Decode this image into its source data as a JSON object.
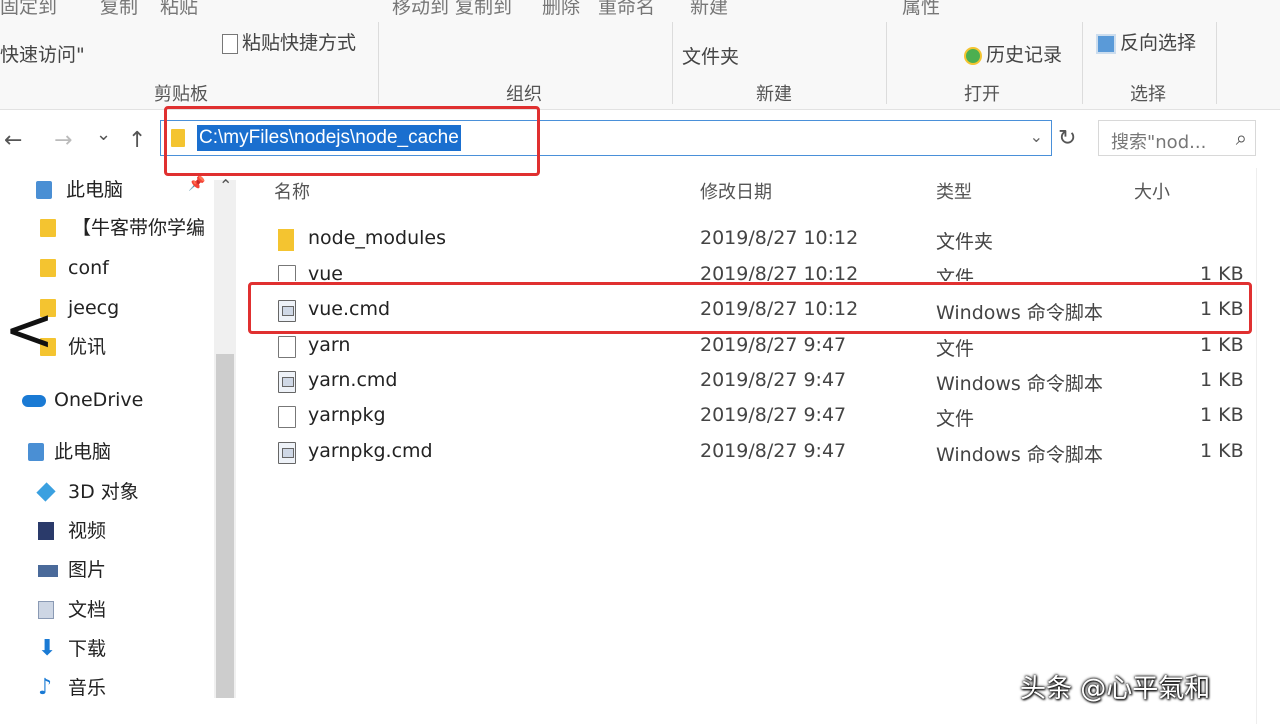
{
  "ribbon": {
    "top_fragments": [
      "固定到",
      "复制",
      "粘贴",
      "移动到 复制到",
      "删除",
      "重命名",
      "新建",
      "属性"
    ],
    "pin_quick_access": "快速访问\"",
    "paste_shortcut": "粘贴快捷方式",
    "new_folder": "文件夹",
    "history": "历史记录",
    "invert_selection": "反向选择",
    "groups": {
      "clipboard": "剪贴板",
      "organize": "组织",
      "new": "新建",
      "open": "打开",
      "select": "选择"
    }
  },
  "nav": {
    "back": "←",
    "forward": "→",
    "recent": "⌄",
    "up": "↑",
    "address_path": "C:\\myFiles\\nodejs\\node_cache",
    "dropdown": "⌄",
    "refresh": "↻",
    "search_placeholder": "搜索\"nod...",
    "search_icon": "⌕"
  },
  "sidebar": {
    "items": [
      {
        "label": "此电脑",
        "icon": "pc-icon"
      },
      {
        "label": "【牛客带你学编",
        "icon": "folder-icon"
      },
      {
        "label": "conf",
        "icon": "folder-icon"
      },
      {
        "label": "jeecg",
        "icon": "folder-icon"
      },
      {
        "label": "优讯",
        "icon": "folder-icon"
      },
      {
        "label": "OneDrive",
        "icon": "onedrive-icon"
      },
      {
        "label": "此电脑",
        "icon": "pc-icon"
      },
      {
        "label": "3D 对象",
        "icon": "3d-objects-icon"
      },
      {
        "label": "视频",
        "icon": "video-icon"
      },
      {
        "label": "图片",
        "icon": "pictures-icon"
      },
      {
        "label": "文档",
        "icon": "documents-icon"
      },
      {
        "label": "下载",
        "icon": "downloads-icon"
      },
      {
        "label": "音乐",
        "icon": "music-icon"
      }
    ],
    "back_overlay": "<"
  },
  "columns": {
    "name": "名称",
    "date": "修改日期",
    "type": "类型",
    "size": "大小"
  },
  "files": [
    {
      "name": "node_modules",
      "date": "2019/8/27 10:12",
      "type": "文件夹",
      "size": "",
      "icon": "folder-icon"
    },
    {
      "name": "vue",
      "date": "2019/8/27 10:12",
      "type": "文件",
      "size": "1 KB",
      "icon": "file-icon"
    },
    {
      "name": "vue.cmd",
      "date": "2019/8/27 10:12",
      "type": "Windows 命令脚本",
      "size": "1 KB",
      "icon": "cmd-file-icon"
    },
    {
      "name": "yarn",
      "date": "2019/8/27 9:47",
      "type": "文件",
      "size": "1 KB",
      "icon": "file-icon"
    },
    {
      "name": "yarn.cmd",
      "date": "2019/8/27 9:47",
      "type": "Windows 命令脚本",
      "size": "1 KB",
      "icon": "cmd-file-icon"
    },
    {
      "name": "yarnpkg",
      "date": "2019/8/27 9:47",
      "type": "文件",
      "size": "1 KB",
      "icon": "file-icon"
    },
    {
      "name": "yarnpkg.cmd",
      "date": "2019/8/27 9:47",
      "type": "Windows 命令脚本",
      "size": "1 KB",
      "icon": "cmd-file-icon"
    }
  ],
  "watermark": "头条 @心平氣和",
  "colors": {
    "highlight_box": "#e03030",
    "selection": "#1a6fcf",
    "folder": "#f4c430"
  }
}
